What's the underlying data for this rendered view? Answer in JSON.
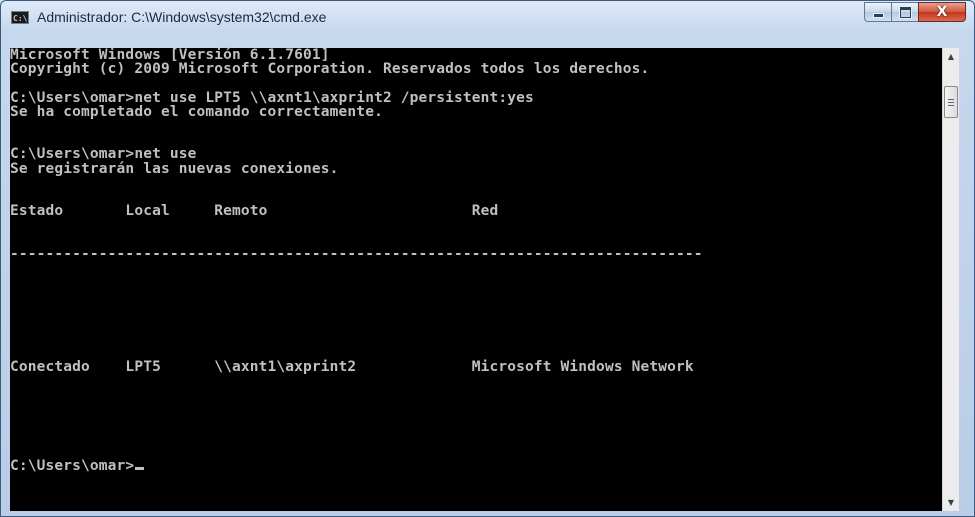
{
  "window": {
    "title": "Administrador: C:\\Windows\\system32\\cmd.exe",
    "icon": "cmd-icon",
    "icon_text": "C:\\"
  },
  "caption_buttons": {
    "minimize_icon": "minimize-icon",
    "maximize_icon": "maximize-icon",
    "close_icon": "close-icon",
    "close_glyph": "X"
  },
  "console": {
    "text_color": "#c0c0c0",
    "background": "#000000",
    "lines": [
      "Microsoft Windows [Versión 6.1.7601]",
      "Copyright (c) 2009 Microsoft Corporation. Reservados todos los derechos.",
      "",
      "C:\\Users\\omar>net use LPT5 \\\\axnt1\\axprint2 /persistent:yes",
      "Se ha completado el comando correctamente.",
      "",
      "",
      "C:\\Users\\omar>net use",
      "Se registrarán las nuevas conexiones.",
      "",
      "",
      "Estado       Local     Remoto                       Red",
      "",
      "",
      "------------------------------------------------------------------------------",
      "",
      "",
      "",
      "",
      "",
      "",
      "",
      "Conectado    LPT5      \\\\axnt1\\axprint2             Microsoft Windows Network",
      "",
      "",
      "",
      "",
      "",
      "",
      "C:\\Users\\omar>"
    ]
  },
  "scrollbar": {
    "up_icon": "scroll-up-arrow-icon",
    "down_icon": "scroll-down-arrow-icon",
    "up_glyph": "▲",
    "down_glyph": "▼"
  }
}
